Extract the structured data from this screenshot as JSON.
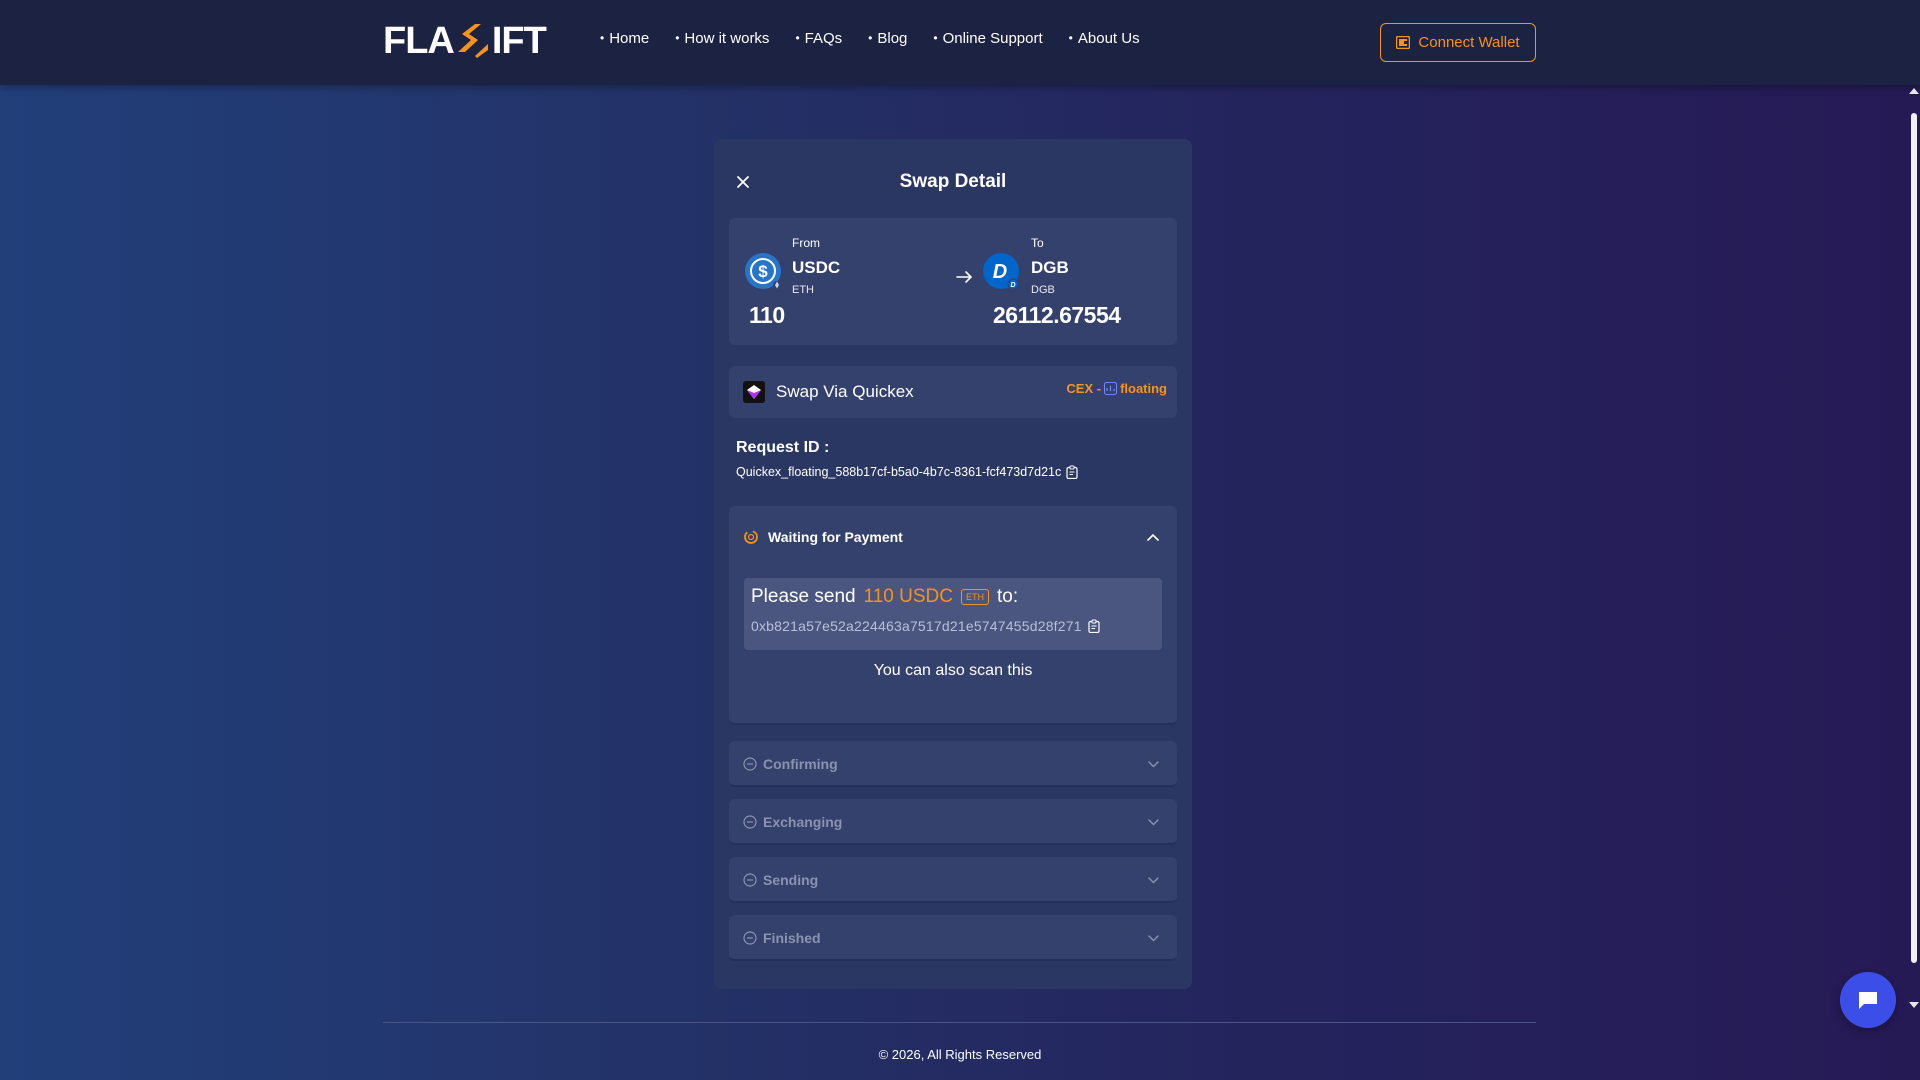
{
  "header": {
    "logo": {
      "part_a": "FLA",
      "part_c": "IFT"
    },
    "nav": [
      "Home",
      "How it works",
      "FAQs",
      "Blog",
      "Online Support",
      "About Us"
    ],
    "connect_wallet": "Connect Wallet"
  },
  "card": {
    "title": "Swap Detail",
    "from": {
      "label": "From",
      "symbol": "USDC",
      "network": "ETH",
      "amount": "110"
    },
    "to": {
      "label": "To",
      "symbol": "DGB",
      "network": "DGB",
      "amount": "26112.67554"
    },
    "via": {
      "text": "Swap Via Quickex",
      "tag_prefix": "CEX -",
      "tag_suffix": "floating"
    },
    "request": {
      "label": "Request ID :",
      "value": "Quickex_floating_588b17cf-b5a0-4b7c-8361-fcf473d7d21c"
    },
    "waiting": {
      "title": "Waiting for Payment",
      "send_prefix": "Please send",
      "send_amount": "110 USDC",
      "send_badge": "ETH",
      "send_suffix": "to:",
      "address": "0xb821a57e52a224463a7517d21e5747455d28f271",
      "scan_text": "You can also scan this"
    },
    "steps": [
      "Confirming",
      "Exchanging",
      "Sending",
      "Finished"
    ]
  },
  "footer": {
    "text": "© 2026, All Rights Reserved"
  },
  "colors": {
    "accent": "#f7931a",
    "card": "#2a3762",
    "panel": "#34416d",
    "chat": "#3b4fe8"
  }
}
